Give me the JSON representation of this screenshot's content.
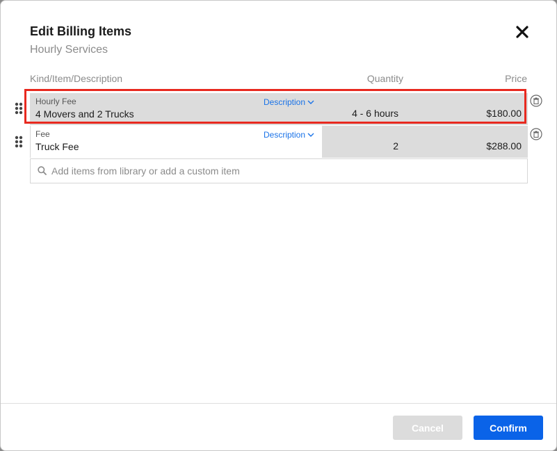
{
  "dialog": {
    "title": "Edit Billing Items",
    "subtitle": "Hourly Services"
  },
  "columns": {
    "kind": "Kind/Item/Description",
    "quantity": "Quantity",
    "price": "Price"
  },
  "items": [
    {
      "kind": "Hourly Fee",
      "name": "4 Movers and 2 Trucks",
      "description_link": "Description",
      "quantity": "4 - 6 hours",
      "price": "$180.00",
      "selected": true
    },
    {
      "kind": "Fee",
      "name": "Truck Fee",
      "description_link": "Description",
      "quantity": "2",
      "price": "$288.00",
      "selected": false
    }
  ],
  "search": {
    "placeholder": "Add items from library or add a custom item"
  },
  "footer": {
    "cancel_label": "Cancel",
    "confirm_label": "Confirm"
  },
  "colors": {
    "accent": "#0a63e8",
    "link": "#1a73e8",
    "highlight": "#e8291f",
    "row_fill": "#dcdcdc"
  }
}
